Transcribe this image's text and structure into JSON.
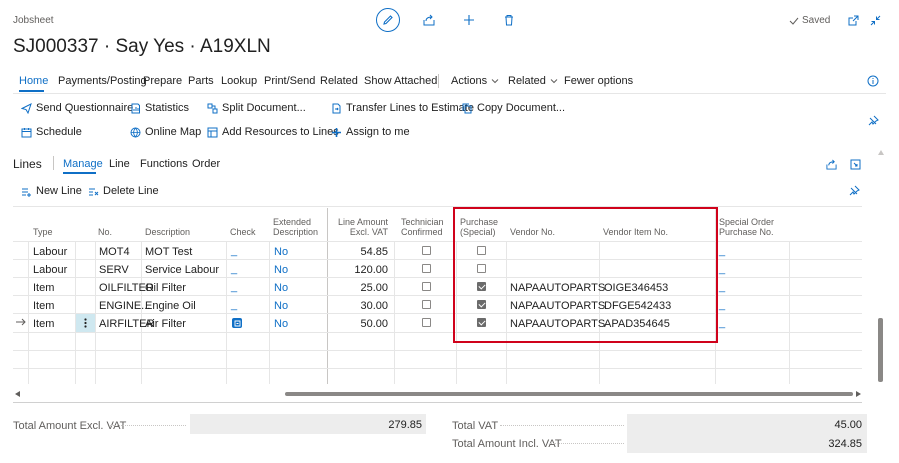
{
  "header": {
    "breadcrumb": "Jobsheet",
    "title": "SJ000337 · Say Yes · A19XLN",
    "saved_label": "Saved"
  },
  "nav": {
    "items": [
      "Home",
      "Payments/Posting",
      "Prepare",
      "Parts",
      "Lookup",
      "Print/Send",
      "Related",
      "Show Attached"
    ],
    "actions_label": "Actions",
    "related_label": "Related",
    "fewer_options_label": "Fewer options"
  },
  "actions": {
    "send_questionnaire": "Send Questionnaire",
    "statistics": "Statistics",
    "split_document": "Split Document...",
    "transfer_lines": "Transfer Lines to Estimate",
    "copy_document": "Copy Document...",
    "schedule": "Schedule",
    "online_map": "Online Map",
    "add_resources": "Add Resources to Lines",
    "assign_to_me": "Assign to me"
  },
  "lines": {
    "title": "Lines",
    "tabs": [
      "Manage",
      "Line",
      "Functions",
      "Order"
    ],
    "new_line": "New Line",
    "delete_line": "Delete Line",
    "columns": {
      "type": "Type",
      "no": "No.",
      "description": "Description",
      "check": "Check",
      "extended_description": "Extended Description",
      "line_amount": "Line Amount Excl. VAT",
      "technician_confirmed": "Technician Confirmed",
      "purchase_special": "Purchase (Special)",
      "vendor_no": "Vendor No.",
      "vendor_item_no": "Vendor Item No.",
      "special_order": "Special Order Purchase No."
    },
    "rows": [
      {
        "type": "Labour",
        "no": "MOT4",
        "description": "MOT Test",
        "check": "_",
        "extended": "No",
        "amount": "54.85",
        "tech": false,
        "purchase": false,
        "vendor": "",
        "vendor_item": "",
        "special": "_"
      },
      {
        "type": "Labour",
        "no": "SERV",
        "description": "Service Labour",
        "check": "_",
        "extended": "No",
        "amount": "120.00",
        "tech": false,
        "purchase": false,
        "vendor": "",
        "vendor_item": "",
        "special": "_"
      },
      {
        "type": "Item",
        "no": "OILFILTER",
        "description": "Oil Filter",
        "check": "_",
        "extended": "No",
        "amount": "25.00",
        "tech": false,
        "purchase": true,
        "vendor": "NAPAAUTOPARTS",
        "vendor_item": "OIGE346453",
        "special": "_"
      },
      {
        "type": "Item",
        "no": "ENGINE...",
        "description": "Engine Oil",
        "check": "_",
        "extended": "No",
        "amount": "30.00",
        "tech": false,
        "purchase": true,
        "vendor": "NAPAAUTOPARTS",
        "vendor_item": "DFGE542433",
        "special": "_"
      },
      {
        "type": "Item",
        "no": "AIRFILTER",
        "description": "Air Filter",
        "check": "",
        "extended": "No",
        "amount": "50.00",
        "tech": false,
        "purchase": true,
        "vendor": "NAPAAUTOPARTS",
        "vendor_item": "APAD354645",
        "special": "_"
      }
    ]
  },
  "totals": {
    "excl_label": "Total Amount Excl. VAT",
    "excl_value": "279.85",
    "vat_label": "Total VAT",
    "vat_value": "45.00",
    "incl_label": "Total Amount Incl. VAT",
    "incl_value": "324.85"
  },
  "colors": {
    "accent": "#0f6fc6",
    "highlight_border": "#d0021b"
  }
}
